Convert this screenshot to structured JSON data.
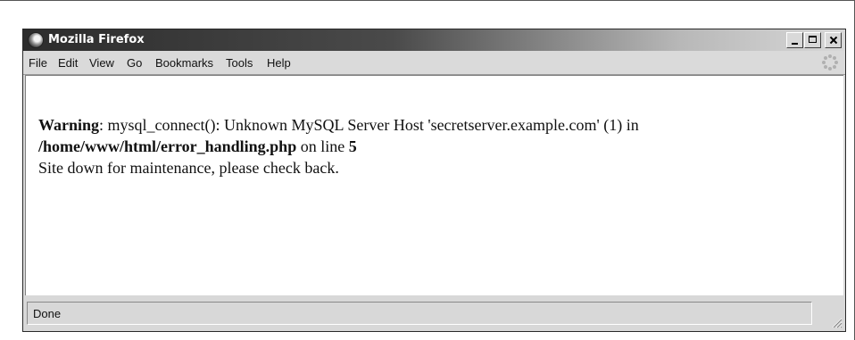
{
  "window": {
    "title": "Mozilla Firefox",
    "logo_icon": "firefox-logo-icon"
  },
  "controls": {
    "minimize_icon": "minimize-icon",
    "maximize_icon": "maximize-icon",
    "close_icon": "close-icon"
  },
  "menu": {
    "items": [
      {
        "label": "File"
      },
      {
        "label": "Edit"
      },
      {
        "label": "View"
      },
      {
        "label": "Go"
      },
      {
        "label": "Bookmarks"
      },
      {
        "label": "Tools"
      },
      {
        "label": "Help"
      }
    ],
    "throbber_icon": "throbber-icon"
  },
  "page": {
    "warning_label": "Warning",
    "warning_message": ": mysql_connect(): Unknown MySQL Server Host 'secretserver.example.com' (1) in",
    "file_path": "/home/www/html/error_handling.php",
    "on_line_text": " on line ",
    "line_number": "5",
    "maintenance_message": "Site down for maintenance, please check back."
  },
  "status": {
    "text": "Done",
    "grip_icon": "resize-grip-icon"
  }
}
